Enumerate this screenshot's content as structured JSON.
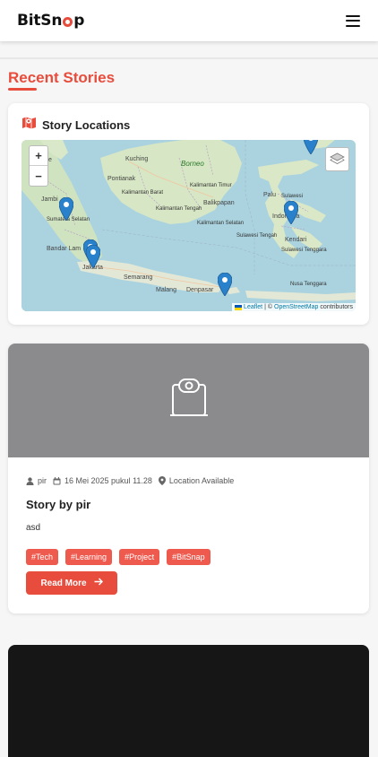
{
  "header": {
    "logo_prefix": "BitSn",
    "logo_suffix": "p",
    "menu_icon": "hamburger-icon",
    "accent_color": "#e74c3c"
  },
  "section": {
    "title": "Recent Stories"
  },
  "locations": {
    "title": "Story Locations",
    "icon": "map-icon",
    "zoom_in": "+",
    "zoom_out": "−",
    "attribution": {
      "leaflet": "Leaflet",
      "separator": "| ©",
      "osm": "OpenStreetMap",
      "suffix": "contributors"
    },
    "map_labels": {
      "borneo": "Borneo",
      "kuching": "Kuching",
      "pontianak": "Pontianak",
      "balikpapan": "Balikpapan",
      "jambi": "Jambi",
      "bandar_lampung": "Bandar Lam",
      "jakarta": "Jakarta",
      "semarang": "Semarang",
      "malang": "Malang",
      "denpasar": "Denpasar",
      "palu": "Palu",
      "kendari": "Kendari",
      "sulawesi": "Sulawesi",
      "indonesia": "Indonesia",
      "singapore": "apore",
      "kalimantan_barat": "Kalimantan Barat",
      "kalimantan_tengah": "Kalimantan Tengah",
      "kalimantan_selatan": "Kalimantan Selatan",
      "kalimantan_timur": "Kalimantan Timur",
      "sulawesi_tengah": "Sulawesi Tengah",
      "sulawesi_tenggara": "Sulawesi Tenggara",
      "sumatera_selatan": "Sumatera Selatan",
      "lesser": "Nusa Tenggara"
    }
  },
  "story": {
    "author": "pir",
    "date": "16 Mei 2025 pukul 11.28",
    "location": "Location Available",
    "title": "Story by pir",
    "description": "asd",
    "tags": [
      "#Tech",
      "#Learning",
      "#Project",
      "#BitSnap"
    ],
    "read_more": "Read More",
    "image_icon": "webcam-icon"
  }
}
